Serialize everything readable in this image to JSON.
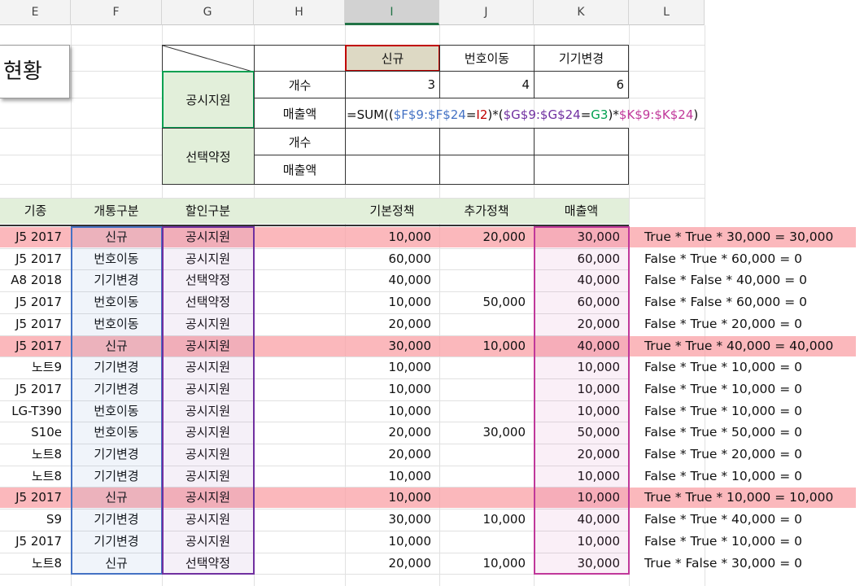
{
  "columns": [
    "E",
    "F",
    "G",
    "H",
    "I",
    "J",
    "K",
    "L"
  ],
  "title_partial": "현황",
  "summary": {
    "header": [
      "신규",
      "번호이동",
      "기기변경"
    ],
    "group1": "공시지원",
    "group2": "선택약정",
    "label_count": "개수",
    "label_sales": "매출액",
    "counts": [
      "3",
      "4",
      "6"
    ],
    "formula": {
      "p1": "=SUM((",
      "p2": "$F$9:$F$24",
      "p3": "=",
      "p4": "I2",
      "p5": ")*(",
      "p6": "$G$9:$G$24",
      "p7": "=",
      "p8": "G3",
      "p9": ")*",
      "p10": "$K$9:$K$24",
      "p11": ")"
    }
  },
  "table": {
    "headers": [
      "기종",
      "개통구분",
      "할인구분",
      "기본정책",
      "추가정책",
      "매출액"
    ],
    "rows": [
      {
        "model": "J5 2017",
        "type": "신규",
        "discount": "공시지원",
        "base": "10,000",
        "extra": "20,000",
        "sales": "30,000",
        "calc": "True * True * 30,000  = 30,000"
      },
      {
        "model": "J5 2017",
        "type": "번호이동",
        "discount": "공시지원",
        "base": "60,000",
        "extra": "",
        "sales": "60,000",
        "calc": "False * True * 60,000  = 0"
      },
      {
        "model": "A8 2018",
        "type": "기기변경",
        "discount": "선택약정",
        "base": "40,000",
        "extra": "",
        "sales": "40,000",
        "calc": "False * False * 40,000  = 0"
      },
      {
        "model": "J5 2017",
        "type": "번호이동",
        "discount": "선택약정",
        "base": "10,000",
        "extra": "50,000",
        "sales": "60,000",
        "calc": "False * False * 60,000  = 0"
      },
      {
        "model": "J5 2017",
        "type": "번호이동",
        "discount": "공시지원",
        "base": "20,000",
        "extra": "",
        "sales": "20,000",
        "calc": "False * True * 20,000  = 0"
      },
      {
        "model": "J5 2017",
        "type": "신규",
        "discount": "공시지원",
        "base": "30,000",
        "extra": "10,000",
        "sales": "40,000",
        "calc": "True * True * 40,000  = 40,000"
      },
      {
        "model": "노트9",
        "type": "기기변경",
        "discount": "공시지원",
        "base": "10,000",
        "extra": "",
        "sales": "10,000",
        "calc": "False * True * 10,000  = 0"
      },
      {
        "model": "J5 2017",
        "type": "기기변경",
        "discount": "공시지원",
        "base": "10,000",
        "extra": "",
        "sales": "10,000",
        "calc": "False * True * 10,000  = 0"
      },
      {
        "model": "LG-T390",
        "type": "번호이동",
        "discount": "공시지원",
        "base": "10,000",
        "extra": "",
        "sales": "10,000",
        "calc": "False * True * 10,000  = 0"
      },
      {
        "model": "S10e",
        "type": "번호이동",
        "discount": "공시지원",
        "base": "20,000",
        "extra": "30,000",
        "sales": "50,000",
        "calc": "False * True * 50,000  = 0"
      },
      {
        "model": "노트8",
        "type": "기기변경",
        "discount": "공시지원",
        "base": "20,000",
        "extra": "",
        "sales": "20,000",
        "calc": "False * True * 20,000  = 0"
      },
      {
        "model": "노트8",
        "type": "기기변경",
        "discount": "공시지원",
        "base": "10,000",
        "extra": "",
        "sales": "10,000",
        "calc": "False * True * 10,000  = 0"
      },
      {
        "model": "J5 2017",
        "type": "신규",
        "discount": "공시지원",
        "base": "10,000",
        "extra": "",
        "sales": "10,000",
        "calc": "True * True * 10,000  = 10,000"
      },
      {
        "model": "S9",
        "type": "기기변경",
        "discount": "공시지원",
        "base": "30,000",
        "extra": "10,000",
        "sales": "40,000",
        "calc": "False * True * 40,000  = 0"
      },
      {
        "model": "J5 2017",
        "type": "기기변경",
        "discount": "공시지원",
        "base": "10,000",
        "extra": "",
        "sales": "10,000",
        "calc": "False * True * 10,000  = 0"
      },
      {
        "model": "노트8",
        "type": "신규",
        "discount": "선택약정",
        "base": "20,000",
        "extra": "10,000",
        "sales": "30,000",
        "calc": "True * False * 30,000  = 0"
      }
    ],
    "highlight_rows": [
      0,
      5,
      12
    ]
  },
  "colors": {
    "header_green": "#e2efda",
    "highlight_pink": "#fba0a5",
    "range_blue": "#4472c4",
    "range_purple": "#7030a0",
    "range_magenta": "#c0389a",
    "ref_red": "#c00000",
    "ref_green": "#00a050",
    "selection_green": "#217346"
  }
}
